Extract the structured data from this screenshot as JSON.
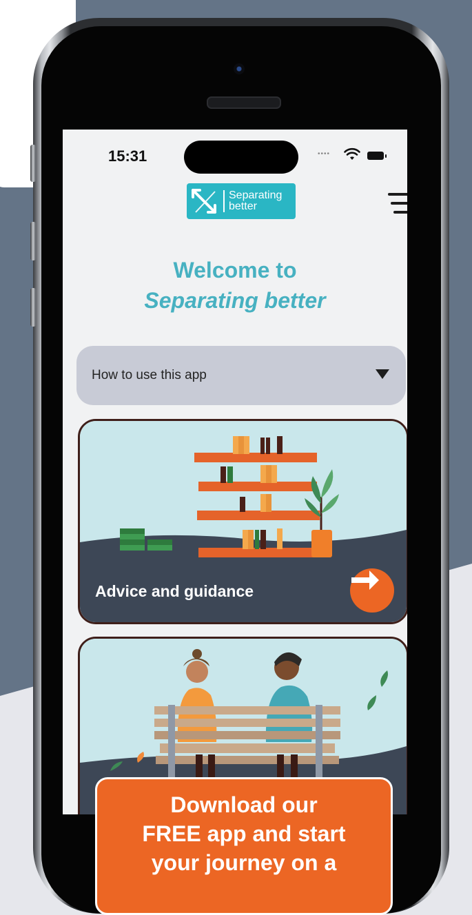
{
  "status_bar": {
    "time": "15:31"
  },
  "logo": {
    "text_line1": "Separating",
    "text_line2": "better"
  },
  "welcome": {
    "line1": "Welcome to",
    "line2": "Separating better"
  },
  "accordion": {
    "label": "How to use this app"
  },
  "cards": [
    {
      "label": "Advice and guidance"
    },
    {
      "label": ""
    }
  ],
  "cta": {
    "line1": "Download our",
    "line2": "FREE app and start",
    "line3": "your journey on a"
  },
  "colors": {
    "brand_teal": "#2ab6c4",
    "accent_orange": "#ec6624",
    "slate_bg": "#647487",
    "card_dark": "#3d4756"
  },
  "icons": [
    "camera-icon",
    "wifi-icon",
    "battery-icon",
    "logo-arrows-icon",
    "menu-icon",
    "chevron-down-icon",
    "arrow-right-icon"
  ]
}
